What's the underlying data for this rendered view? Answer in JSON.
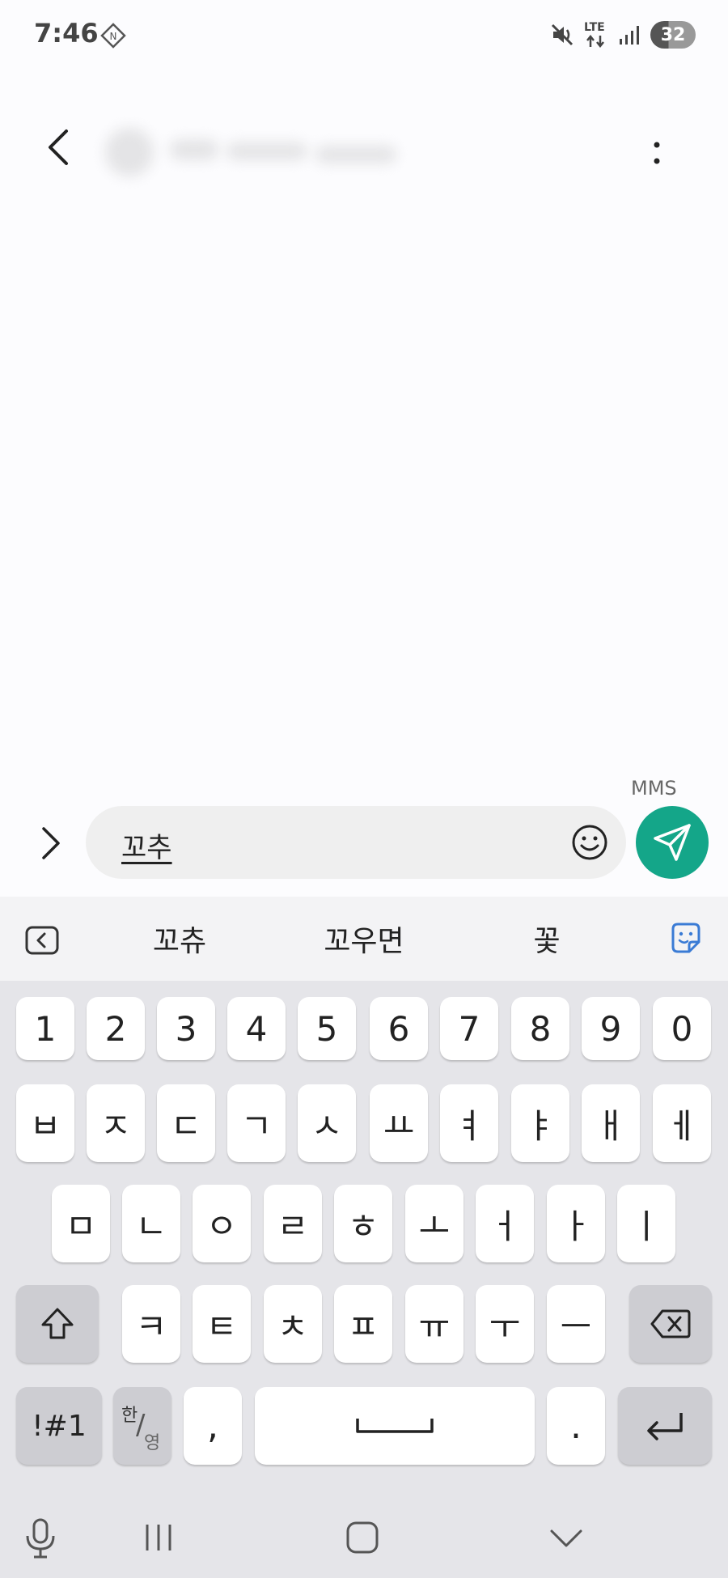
{
  "status_bar": {
    "time": "7:46",
    "battery": "32",
    "network": "LTE"
  },
  "header": {
    "contact_name": ""
  },
  "composer": {
    "mms_label": "MMS",
    "input_value": "꼬추"
  },
  "suggestions": [
    "꼬츄",
    "꼬우면",
    "꽃"
  ],
  "keyboard": {
    "row_numbers": [
      "1",
      "2",
      "3",
      "4",
      "5",
      "6",
      "7",
      "8",
      "9",
      "0"
    ],
    "row1": [
      "ㅂ",
      "ㅈ",
      "ㄷ",
      "ㄱ",
      "ㅅ",
      "ㅛ",
      "ㅕ",
      "ㅑ",
      "ㅐ",
      "ㅔ"
    ],
    "row2": [
      "ㅁ",
      "ㄴ",
      "ㅇ",
      "ㄹ",
      "ㅎ",
      "ㅗ",
      "ㅓ",
      "ㅏ",
      "ㅣ"
    ],
    "row3": [
      "ㅋ",
      "ㅌ",
      "ㅊ",
      "ㅍ",
      "ㅠ",
      "ㅜ",
      "ㅡ"
    ],
    "symbols_label": "!#1",
    "lang_top": "한",
    "lang_bottom": "영",
    "comma": ",",
    "period": "."
  },
  "colors": {
    "send_button": "#14a689",
    "sticker_icon": "#3a7bd5"
  },
  "icons": [
    "back-arrow-icon",
    "more-vert-icon",
    "chevron-right-icon",
    "emoji-icon",
    "send-icon",
    "collapse-icon",
    "sticker-icon",
    "shift-icon",
    "backspace-icon",
    "space-icon",
    "enter-icon",
    "mic-icon",
    "recents-icon",
    "home-icon",
    "nav-back-icon"
  ]
}
